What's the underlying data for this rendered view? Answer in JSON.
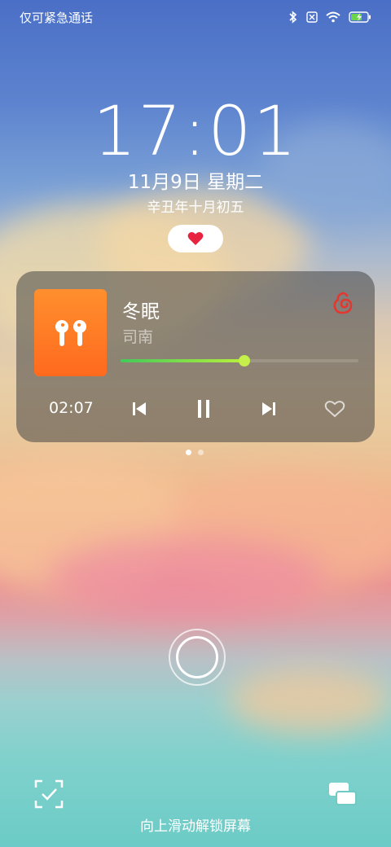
{
  "status_bar": {
    "carrier_text": "仅可紧急通话",
    "icons": [
      "bluetooth-icon",
      "sim-none-icon",
      "wifi-icon",
      "battery-charging-icon"
    ]
  },
  "lockscreen": {
    "time": "17:01",
    "date": "11月9日  星期二",
    "lunar_date": "辛丑年十月初五",
    "unlock_hint": "向上滑动解锁屏幕"
  },
  "music": {
    "song_title": "冬眠",
    "artist": "司南",
    "elapsed": "02:07",
    "progress": 0.52,
    "app_icon": "netease-music-icon",
    "cover_icon": "earbuds-icon",
    "controls": [
      "previous-icon",
      "pause-icon",
      "next-icon",
      "like-heart-icon"
    ],
    "accent_color": "#c5ef4b"
  },
  "pager": {
    "pages": 2,
    "active": 0
  },
  "colors": {
    "heart": "#e8233f",
    "cover_top": "#ff8f2e",
    "cover_bottom": "#ff6a1e",
    "app_logo": "#e3382f"
  }
}
